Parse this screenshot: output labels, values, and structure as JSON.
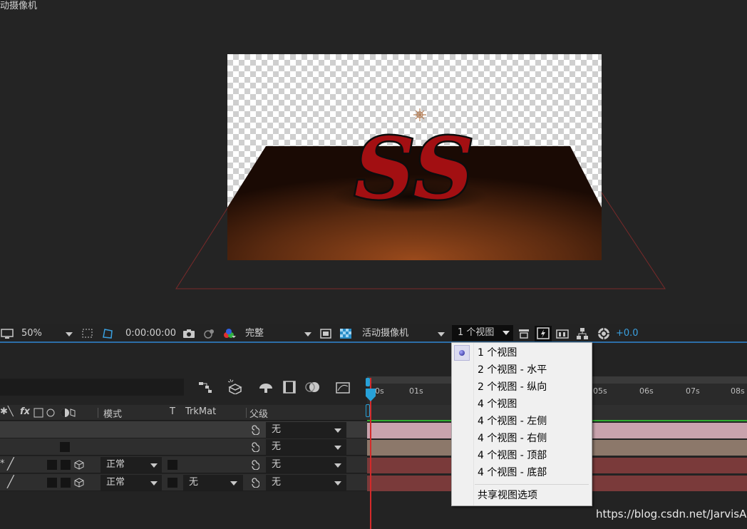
{
  "viewer": {
    "view_label": "动摄像机"
  },
  "toolbar": {
    "zoom": "50%",
    "timecode": "0:00:00:00",
    "resolution": "完整",
    "camera": "活动摄像机",
    "views": "1 个视图",
    "exposure": "+0.0"
  },
  "timeline": {
    "columns": {
      "mode": "模式",
      "t": "T",
      "trkmat": "TrkMat",
      "parent": "父级"
    },
    "rows": [
      {
        "parent": "无"
      },
      {
        "parent": "无"
      },
      {
        "mode": "正常",
        "parent": "无"
      },
      {
        "mode": "正常",
        "trkmat": "无",
        "parent": "无"
      }
    ],
    "ruler_labels": [
      "0s",
      "01s",
      "05s",
      "06s",
      "07s",
      "08s"
    ]
  },
  "menu": {
    "items": [
      {
        "label": "1 个视图",
        "checked": true
      },
      {
        "label": "2 个视图 - 水平"
      },
      {
        "label": "2 个视图 - 纵向"
      },
      {
        "label": "4 个视图"
      },
      {
        "label": "4 个视图 - 左侧"
      },
      {
        "label": "4 个视图 - 右侧"
      },
      {
        "label": "4 个视图 - 顶部"
      },
      {
        "label": "4 个视图 - 底部"
      }
    ],
    "shared": "共享视图选项"
  },
  "watermark": "https://blog.csdn.net/JarvisAI",
  "colors": {
    "accent": "#2c6ea8",
    "playhead": "#d42a2a",
    "track_pink": "#caa0aa",
    "track_tan": "#8c786a",
    "track_red": "#7a3a3a"
  }
}
